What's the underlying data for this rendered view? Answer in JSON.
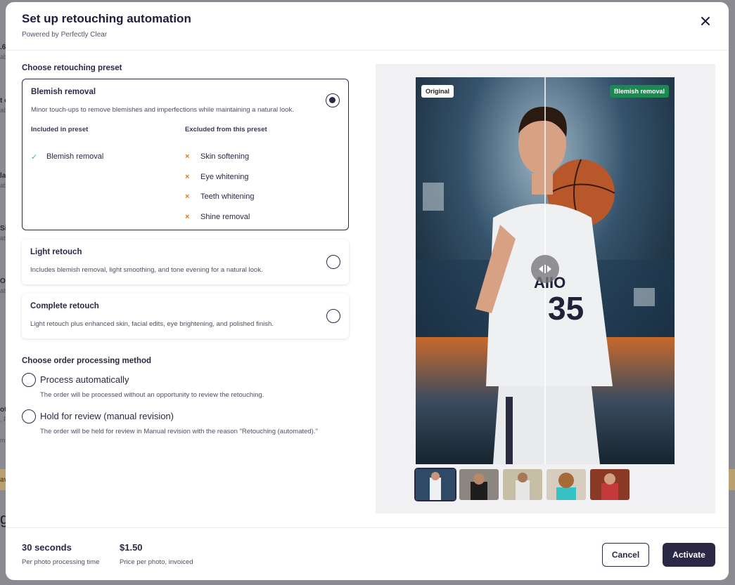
{
  "background": {
    "fragments": [
      ".6",
      "ab",
      "t of",
      "ab",
      "lar",
      "ab",
      "Sil",
      "ab",
      "Ov",
      "ab",
      "oto",
      ", P",
      "ma",
      "av",
      "gr"
    ]
  },
  "modal": {
    "title": "Set up retouching automation",
    "subtitle": "Powered by Perfectly Clear",
    "close_icon": "close-icon"
  },
  "presets": {
    "heading": "Choose retouching preset",
    "items": [
      {
        "title": "Blemish removal",
        "description": "Minor touch-ups to remove blemishes and imperfections while maintaining a natural look.",
        "selected": true,
        "included_heading": "Included in preset",
        "excluded_heading": "Excluded from this preset",
        "included": [
          "Blemish removal"
        ],
        "excluded": [
          "Skin softening",
          "Eye whitening",
          "Teeth whitening",
          "Shine removal"
        ]
      },
      {
        "title": "Light retouch",
        "description": "Includes blemish removal, light smoothing, and tone evening for a natural look.",
        "selected": false
      },
      {
        "title": "Complete retouch",
        "description": "Light retouch plus enhanced skin, facial edits, eye brightening, and polished finish.",
        "selected": false
      }
    ]
  },
  "processing": {
    "heading": "Choose order processing method",
    "options": [
      {
        "label": "Process automatically",
        "description": "The order will be processed without an opportunity to review the retouching."
      },
      {
        "label": "Hold for review (manual revision)",
        "description": "The order will be held for review in Manual revision with the reason \"Retouching (automated).\""
      }
    ]
  },
  "preview": {
    "before_label": "Original",
    "after_label": "Blemish removal",
    "thumbnails_count": 5,
    "active_thumbnail": 1,
    "colors": {
      "after_badge": "#1b8a52"
    }
  },
  "footer": {
    "time_value": "30 seconds",
    "time_label": "Per photo processing time",
    "price_value": "$1.50",
    "price_label": "Price per photo, invoiced",
    "cancel_label": "Cancel",
    "activate_label": "Activate"
  },
  "colors": {
    "accent": "#2a2845",
    "check": "#4bb082",
    "cross": "#e07b1e"
  }
}
